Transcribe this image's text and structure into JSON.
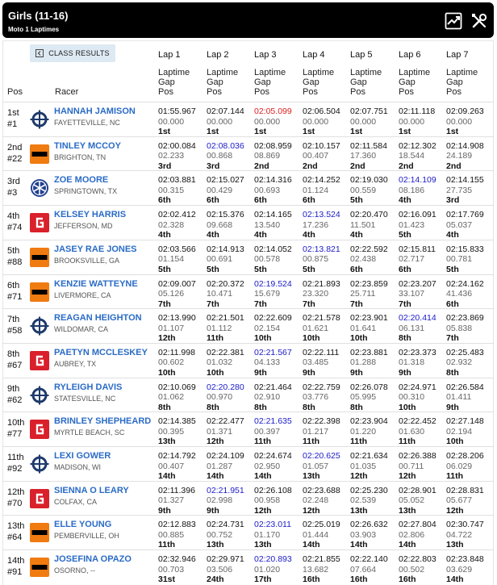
{
  "header": {
    "title": "Girls (11-16)",
    "subtitle": "Moto 1 Laptimes"
  },
  "class_results_label": "CLASS RESULTS",
  "laps": [
    "Lap 1",
    "Lap 2",
    "Lap 3",
    "Lap 4",
    "Lap 5",
    "Lap 6",
    "Lap 7"
  ],
  "sub_labels": [
    "Laptime",
    "Gap",
    "Pos"
  ],
  "col_pos": "Pos",
  "col_racer": "Racer",
  "brand_colors": {
    "husqvarna": "#1e3a6b",
    "ktm": "#f07b11",
    "yamaha": "#1f3f8f",
    "gasgas": "#d9202b"
  },
  "riders": [
    {
      "pos": "1st",
      "num": "#1",
      "name": "HANNAH JAMISON",
      "home": "FAYETTEVILLE, NC",
      "brand": "husqvarna",
      "laps": [
        [
          "01:55.967",
          "00.000",
          "1st",
          ""
        ],
        [
          "02:07.144",
          "00.000",
          "1st",
          ""
        ],
        [
          "02:05.099",
          "00.000",
          "1st",
          "overall"
        ],
        [
          "02:06.504",
          "00.000",
          "1st",
          ""
        ],
        [
          "02:07.751",
          "00.000",
          "1st",
          ""
        ],
        [
          "02:11.118",
          "00.000",
          "1st",
          ""
        ],
        [
          "02:09.263",
          "00.000",
          "1st",
          ""
        ]
      ]
    },
    {
      "pos": "2nd",
      "num": "#22",
      "name": "TINLEY MCCOY",
      "home": "BRIGHTON, TN",
      "brand": "ktm",
      "laps": [
        [
          "02:00.084",
          "02.233",
          "3rd",
          ""
        ],
        [
          "02:08.036",
          "00.868",
          "3rd",
          "best"
        ],
        [
          "02:08.959",
          "08.869",
          "2nd",
          ""
        ],
        [
          "02:10.157",
          "00.407",
          "2nd",
          ""
        ],
        [
          "02:11.584",
          "17.360",
          "2nd",
          ""
        ],
        [
          "02:12.302",
          "18.544",
          "2nd",
          ""
        ],
        [
          "02:14.908",
          "24.189",
          "2nd",
          ""
        ]
      ]
    },
    {
      "pos": "3rd",
      "num": "#3",
      "name": "ZOE MOORE",
      "home": "SPRINGTOWN, TX",
      "brand": "yamaha",
      "laps": [
        [
          "02:03.881",
          "00.315",
          "6th",
          ""
        ],
        [
          "02:15.027",
          "00.429",
          "6th",
          ""
        ],
        [
          "02:14.316",
          "00.693",
          "6th",
          ""
        ],
        [
          "02:14.252",
          "01.124",
          "6th",
          ""
        ],
        [
          "02:19.030",
          "00.559",
          "5th",
          ""
        ],
        [
          "02:14.109",
          "08.186",
          "4th",
          "best"
        ],
        [
          "02:14.155",
          "27.735",
          "3rd",
          ""
        ]
      ]
    },
    {
      "pos": "4th",
      "num": "#74",
      "name": "KELSEY HARRIS",
      "home": "JEFFERSON, MD",
      "brand": "gasgas",
      "laps": [
        [
          "02:02.412",
          "02.328",
          "4th",
          ""
        ],
        [
          "02:15.376",
          "09.668",
          "4th",
          ""
        ],
        [
          "02:14.165",
          "13.540",
          "4th",
          ""
        ],
        [
          "02:13.524",
          "17.236",
          "4th",
          "best"
        ],
        [
          "02:20.470",
          "11.501",
          "4th",
          ""
        ],
        [
          "02:16.091",
          "01.423",
          "5th",
          ""
        ],
        [
          "02:17.769",
          "05.037",
          "4th",
          ""
        ]
      ]
    },
    {
      "pos": "5th",
      "num": "#88",
      "name": "JASEY RAE JONES",
      "home": "BROOKSVILLE, GA",
      "brand": "ktm",
      "laps": [
        [
          "02:03.566",
          "01.154",
          "5th",
          ""
        ],
        [
          "02:14.913",
          "00.691",
          "5th",
          ""
        ],
        [
          "02:14.052",
          "00.578",
          "5th",
          ""
        ],
        [
          "02:13.821",
          "00.875",
          "5th",
          "best"
        ],
        [
          "02:22.592",
          "02.438",
          "6th",
          ""
        ],
        [
          "02:15.811",
          "02.717",
          "6th",
          ""
        ],
        [
          "02:15.833",
          "00.781",
          "5th",
          ""
        ]
      ]
    },
    {
      "pos": "6th",
      "num": "#71",
      "name": "KENZIE WATTEYNE",
      "home": "LIVERMORE, CA",
      "brand": "ktm",
      "laps": [
        [
          "02:09.007",
          "05.126",
          "7th",
          ""
        ],
        [
          "02:20.372",
          "10.471",
          "7th",
          ""
        ],
        [
          "02:19.524",
          "15.679",
          "7th",
          "best"
        ],
        [
          "02:21.893",
          "23.320",
          "7th",
          ""
        ],
        [
          "02:23.859",
          "25.711",
          "7th",
          ""
        ],
        [
          "02:23.207",
          "33.107",
          "7th",
          ""
        ],
        [
          "02:24.162",
          "41.436",
          "6th",
          ""
        ]
      ]
    },
    {
      "pos": "7th",
      "num": "#58",
      "name": "REAGAN HEIGHTON",
      "home": "WILDOMAR, CA",
      "brand": "husqvarna",
      "laps": [
        [
          "02:13.990",
          "01.107",
          "12th",
          ""
        ],
        [
          "02:21.501",
          "01.112",
          "11th",
          ""
        ],
        [
          "02:22.609",
          "02.154",
          "10th",
          ""
        ],
        [
          "02:21.578",
          "01.621",
          "10th",
          ""
        ],
        [
          "02:23.901",
          "01.641",
          "10th",
          ""
        ],
        [
          "02:20.414",
          "06.131",
          "8th",
          "best"
        ],
        [
          "02:23.869",
          "05.838",
          "7th",
          ""
        ]
      ]
    },
    {
      "pos": "8th",
      "num": "#67",
      "name": "PAETYN MCCLESKEY",
      "home": "AUBREY, TX",
      "brand": "gasgas",
      "laps": [
        [
          "02:11.998",
          "00.602",
          "10th",
          ""
        ],
        [
          "02:22.381",
          "01.032",
          "10th",
          ""
        ],
        [
          "02:21.567",
          "04.133",
          "9th",
          "best"
        ],
        [
          "02:22.111",
          "03.485",
          "9th",
          ""
        ],
        [
          "02:23.881",
          "01.288",
          "9th",
          ""
        ],
        [
          "02:23.373",
          "01.318",
          "9th",
          ""
        ],
        [
          "02:25.483",
          "02.932",
          "8th",
          ""
        ]
      ]
    },
    {
      "pos": "9th",
      "num": "#62",
      "name": "RYLEIGH DAVIS",
      "home": "STATESVILLE, NC",
      "brand": "husqvarna",
      "laps": [
        [
          "02:10.069",
          "01.062",
          "8th",
          ""
        ],
        [
          "02:20.280",
          "00.970",
          "8th",
          "best"
        ],
        [
          "02:21.464",
          "02.910",
          "8th",
          ""
        ],
        [
          "02:22.759",
          "03.776",
          "8th",
          ""
        ],
        [
          "02:26.078",
          "05.995",
          "8th",
          ""
        ],
        [
          "02:24.971",
          "00.310",
          "10th",
          ""
        ],
        [
          "02:26.584",
          "01.411",
          "9th",
          ""
        ]
      ]
    },
    {
      "pos": "10th",
      "num": "#77",
      "name": "BRINLEY SHEPHEARD",
      "home": "MYRTLE BEACH, SC",
      "brand": "gasgas",
      "laps": [
        [
          "02:14.385",
          "00.395",
          "13th",
          ""
        ],
        [
          "02:22.477",
          "01.371",
          "12th",
          ""
        ],
        [
          "02:21.635",
          "00.397",
          "11th",
          "best"
        ],
        [
          "02:22.398",
          "01.217",
          "11th",
          ""
        ],
        [
          "02:23.904",
          "01.220",
          "11th",
          ""
        ],
        [
          "02:22.452",
          "01.630",
          "11th",
          ""
        ],
        [
          "02:27.148",
          "02.194",
          "10th",
          ""
        ]
      ]
    },
    {
      "pos": "11th",
      "num": "#92",
      "name": "LEXI GOWER",
      "home": "MADISON, WI",
      "brand": "husqvarna",
      "laps": [
        [
          "02:14.792",
          "00.407",
          "14th",
          ""
        ],
        [
          "02:24.109",
          "01.287",
          "14th",
          ""
        ],
        [
          "02:24.674",
          "02.950",
          "14th",
          ""
        ],
        [
          "02:20.625",
          "01.057",
          "13th",
          "best"
        ],
        [
          "02:21.634",
          "01.035",
          "12th",
          ""
        ],
        [
          "02:26.388",
          "00.711",
          "12th",
          ""
        ],
        [
          "02:28.206",
          "06.029",
          "11th",
          ""
        ]
      ]
    },
    {
      "pos": "12th",
      "num": "#70",
      "name": "SIENNA O LEARY",
      "home": "COLFAX, CA",
      "brand": "gasgas",
      "laps": [
        [
          "02:11.396",
          "01.327",
          "9th",
          ""
        ],
        [
          "02:21.951",
          "02.998",
          "9th",
          "best"
        ],
        [
          "02:26.108",
          "00.958",
          "12th",
          ""
        ],
        [
          "02:23.688",
          "02.248",
          "12th",
          ""
        ],
        [
          "02:25.230",
          "02.539",
          "13th",
          ""
        ],
        [
          "02:28.901",
          "05.052",
          "13th",
          ""
        ],
        [
          "02:28.831",
          "05.677",
          "12th",
          ""
        ]
      ]
    },
    {
      "pos": "13th",
      "num": "#64",
      "name": "ELLE YOUNG",
      "home": "PEMBERVILLE, OH",
      "brand": "ktm",
      "laps": [
        [
          "02:12.883",
          "00.885",
          "11th",
          ""
        ],
        [
          "02:24.731",
          "00.752",
          "13th",
          ""
        ],
        [
          "02:23.011",
          "01.170",
          "13th",
          "best"
        ],
        [
          "02:25.019",
          "01.444",
          "14th",
          ""
        ],
        [
          "02:26.632",
          "03.903",
          "14th",
          ""
        ],
        [
          "02:27.804",
          "02.806",
          "14th",
          ""
        ],
        [
          "02:30.747",
          "04.722",
          "13th",
          ""
        ]
      ]
    },
    {
      "pos": "14th",
      "num": "#91",
      "name": "JOSEFINA OPAZO",
      "home": "OSORNO, --",
      "brand": "ktm",
      "laps": [
        [
          "02:32.946",
          "00.703",
          "31st",
          ""
        ],
        [
          "02:29.971",
          "03.506",
          "24th",
          ""
        ],
        [
          "02:20.893",
          "01.020",
          "17th",
          "best"
        ],
        [
          "02:21.855",
          "13.682",
          "16th",
          ""
        ],
        [
          "02:22.140",
          "07.664",
          "16th",
          ""
        ],
        [
          "02:22.803",
          "00.502",
          "16th",
          ""
        ],
        [
          "02:23.848",
          "03.629",
          "14th",
          ""
        ]
      ]
    }
  ]
}
